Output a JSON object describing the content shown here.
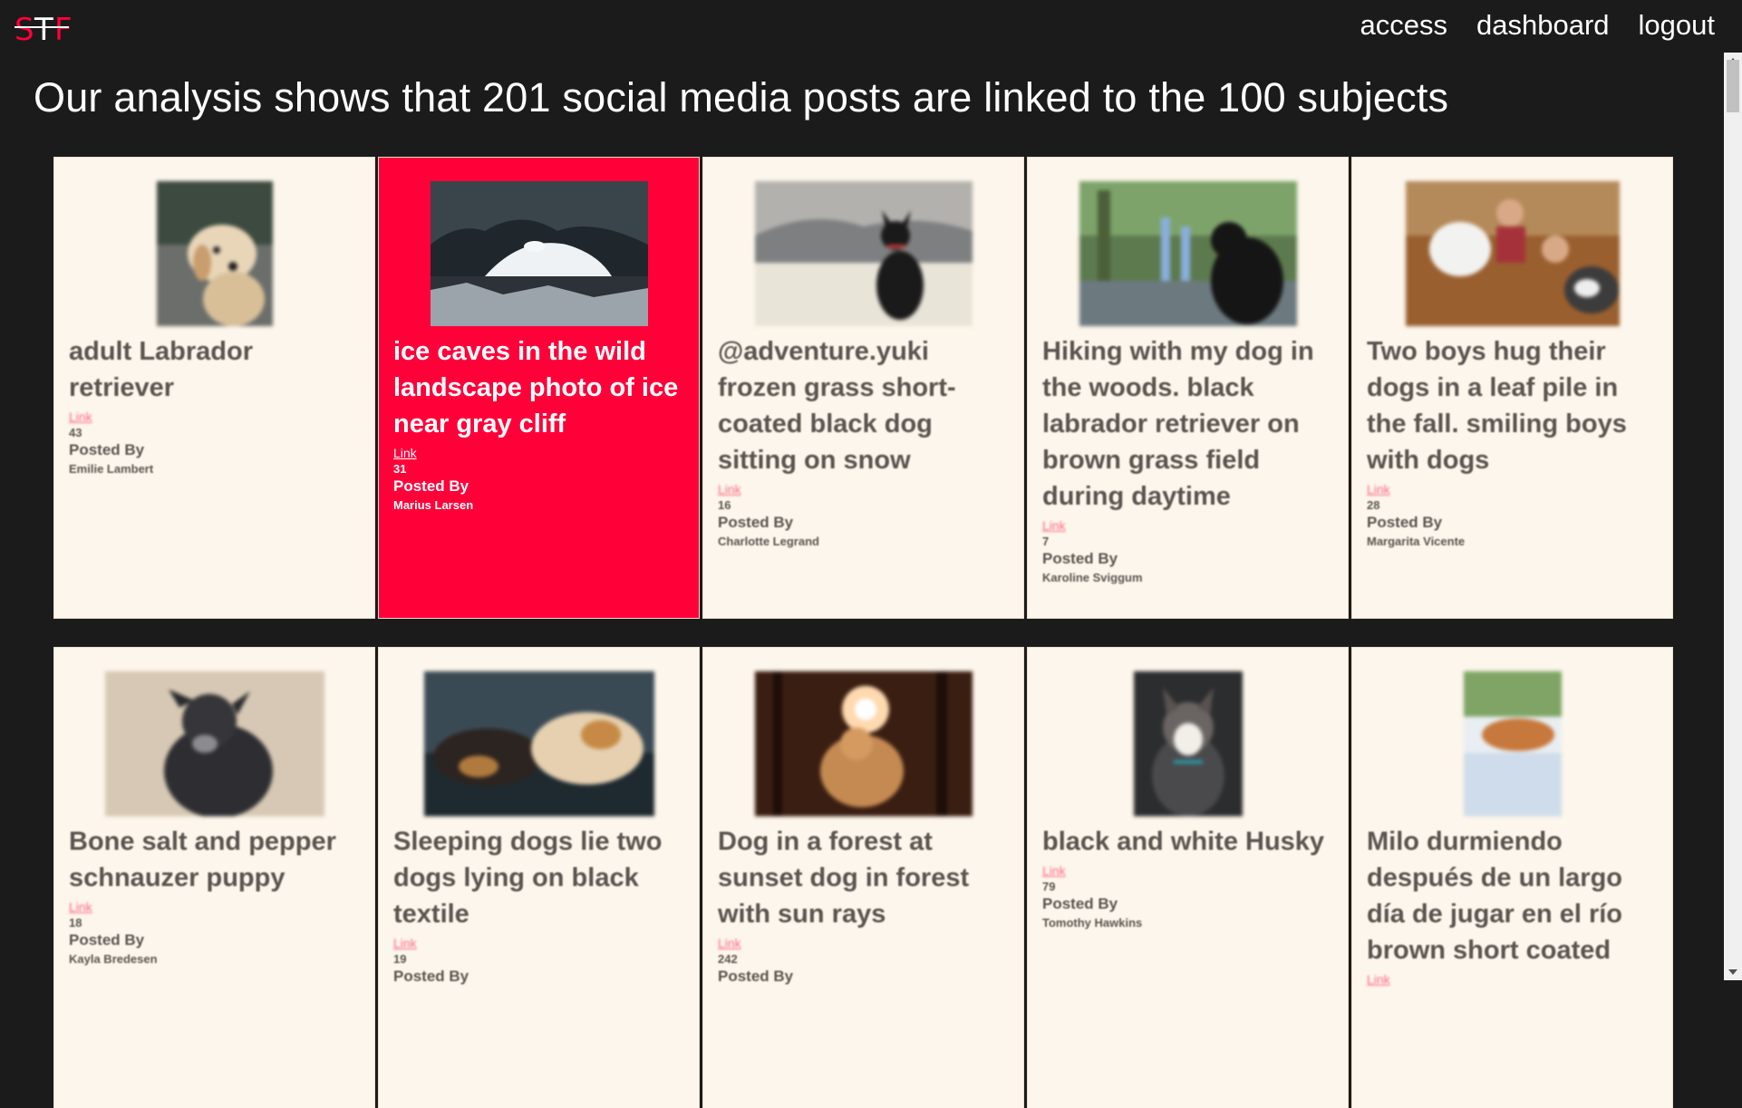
{
  "header": {
    "logo_text": "STF",
    "nav": [
      {
        "label": "access"
      },
      {
        "label": "dashboard"
      },
      {
        "label": "logout"
      }
    ]
  },
  "headline": "Our analysis shows that 201 social media posts are linked to the 100 subjects",
  "cards": [
    {
      "title": "adult Labrador retriever",
      "link_label": "Link",
      "count": "43",
      "posted_by_label": "Posted By",
      "author": "Emilie Lambert",
      "image": "golden-dog-photo"
    },
    {
      "title": "ice caves in the wild landscape photo of ice near gray cliff",
      "link_label": "Link",
      "count": "31",
      "posted_by_label": "Posted By",
      "author": "Marius Larsen",
      "image": "ice-cave-photo"
    },
    {
      "title": "@adventure.yuki frozen grass short-coated black dog sitting on snow",
      "link_label": "Link",
      "count": "16",
      "posted_by_label": "Posted By",
      "author": "Charlotte Legrand",
      "image": "black-dog-snow-photo"
    },
    {
      "title": "Hiking with my dog in the woods. black labrador retriever on brown grass field during daytime",
      "link_label": "Link",
      "count": "7",
      "posted_by_label": "Posted By",
      "author": "Karoline Sviggum",
      "image": "black-lab-woods-photo"
    },
    {
      "title": "Two boys hug their dogs in a leaf pile in the fall. smiling boys with dogs",
      "link_label": "Link",
      "count": "28",
      "posted_by_label": "Posted By",
      "author": "Margarita Vicente",
      "image": "boys-dogs-leaves-photo"
    },
    {
      "title": "Bone salt and pepper schnauzer puppy",
      "link_label": "Link",
      "count": "18",
      "posted_by_label": "Posted By",
      "author": "Kayla Bredesen",
      "image": "schnauzer-puppy-photo"
    },
    {
      "title": "Sleeping dogs lie two dogs lying on black textile",
      "link_label": "Link",
      "count": "19",
      "posted_by_label": "Posted By",
      "author": "",
      "image": "sleeping-dogs-photo"
    },
    {
      "title": "Dog in a forest at sunset dog in forest with sun rays",
      "link_label": "Link",
      "count": "242",
      "posted_by_label": "Posted By",
      "author": "",
      "image": "dog-forest-sunset-photo"
    },
    {
      "title": "black and white Husky",
      "link_label": "Link",
      "count": "79",
      "posted_by_label": "Posted By",
      "author": "Tomothy Hawkins",
      "image": "husky-photo"
    },
    {
      "title": "Milo durmiendo después de un largo día de jugar en el río brown short coated",
      "link_label": "Link",
      "count": "",
      "posted_by_label": "",
      "author": "",
      "image": "milo-sleeping-photo"
    }
  ],
  "colors": {
    "background": "#1b1b1b",
    "card_bg": "#fdf6ec",
    "accent": "#ff0039"
  }
}
